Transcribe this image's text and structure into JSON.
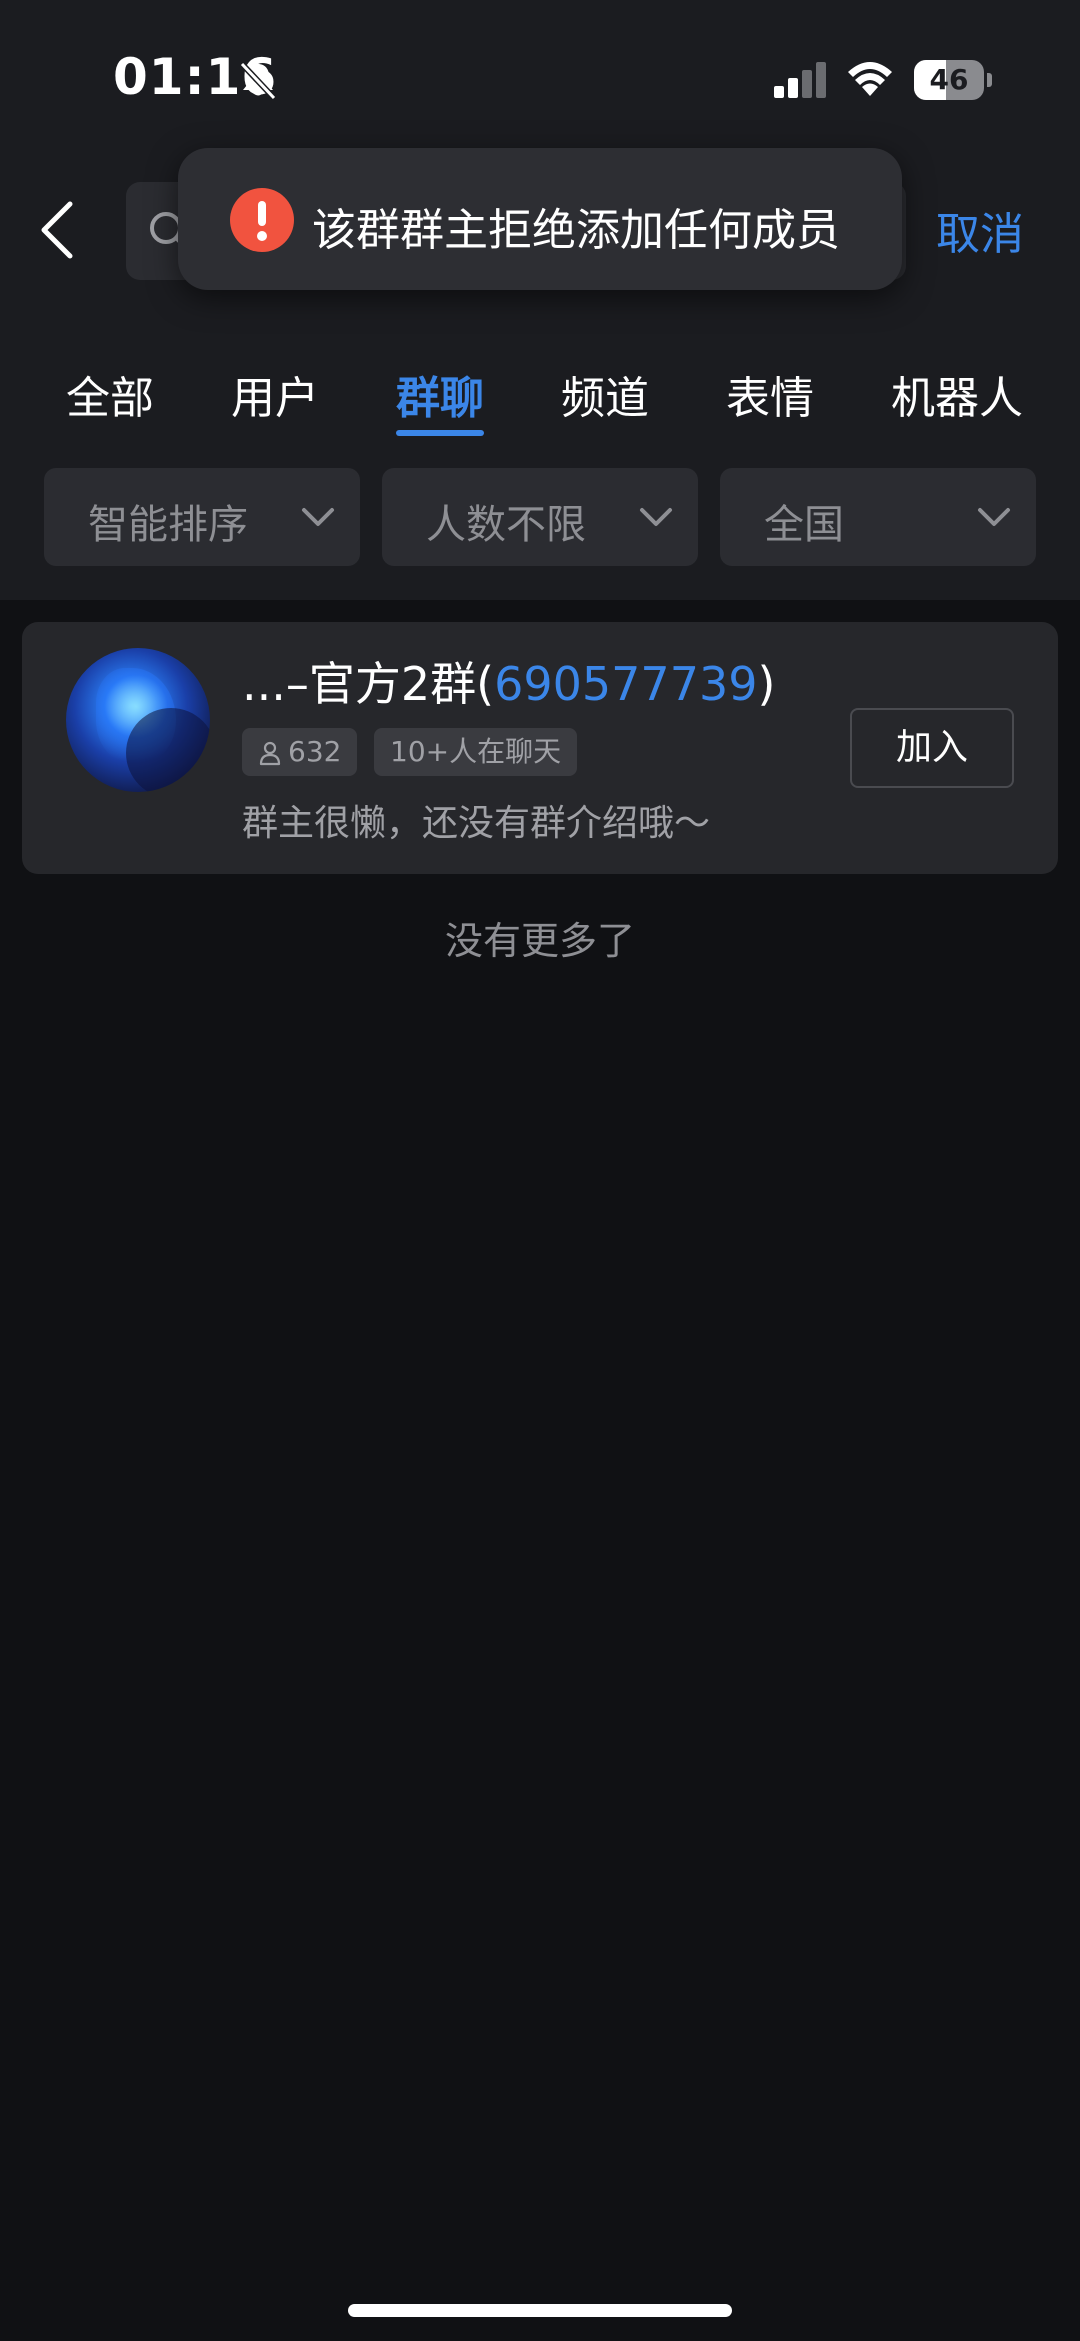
{
  "status_bar": {
    "time": "01:16",
    "battery_level": "46",
    "battery_fraction": 0.46
  },
  "search": {
    "value": "",
    "placeholder": "",
    "cancel_label": "取消"
  },
  "toast": {
    "icon": "error-icon",
    "message": "该群群主拒绝添加任何成员"
  },
  "tabs": [
    {
      "label": "全部",
      "active": false
    },
    {
      "label": "用户",
      "active": false
    },
    {
      "label": "群聊",
      "active": true
    },
    {
      "label": "频道",
      "active": false
    },
    {
      "label": "表情",
      "active": false
    },
    {
      "label": "机器人",
      "active": false
    }
  ],
  "filters": [
    {
      "label": "智能排序"
    },
    {
      "label": "人数不限"
    },
    {
      "label": "全国"
    }
  ],
  "result": {
    "name_prefix": "...–官方2群(",
    "group_number": "690577739",
    "name_suffix": ")",
    "member_count": "632",
    "active_status": "10+人在聊天",
    "intro": "群主很懒，还没有群介绍哦～",
    "join_label": "加入"
  },
  "footer": {
    "no_more": "没有更多了"
  },
  "colors": {
    "accent": "#3b86e8",
    "error": "#f1533f",
    "background": "#101114",
    "header": "#1b1c20"
  }
}
